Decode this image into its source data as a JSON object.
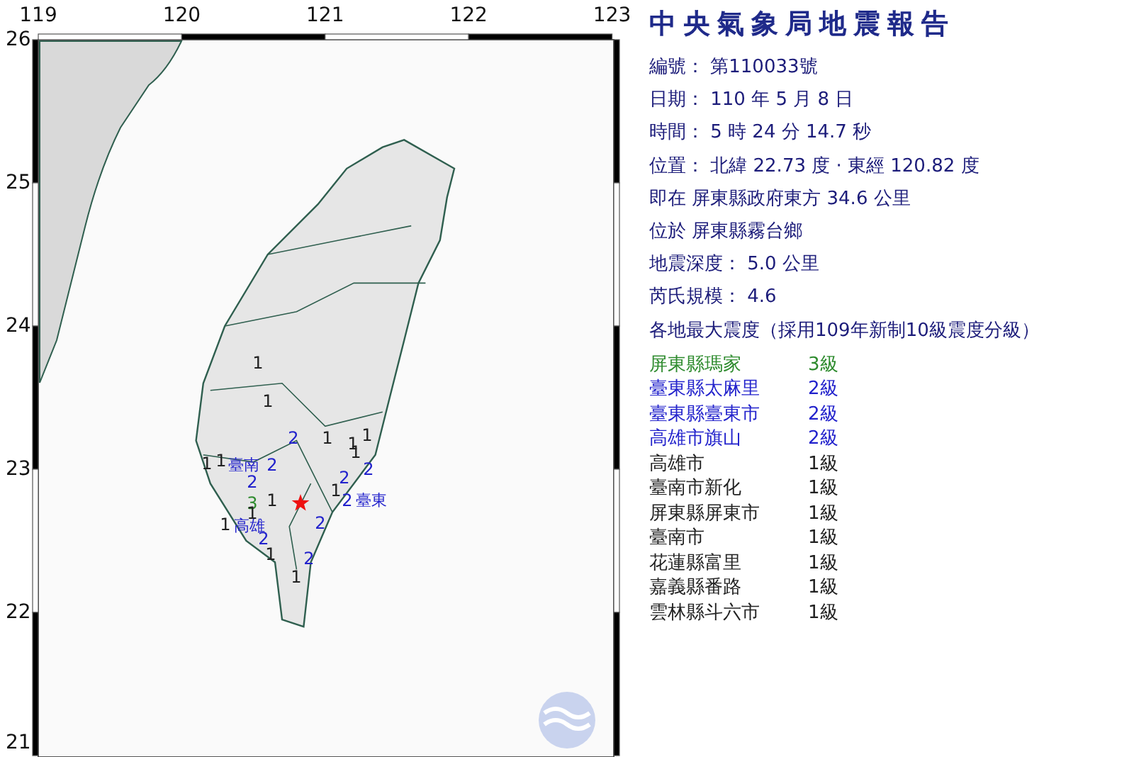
{
  "map": {
    "lon_ticks": [
      "119",
      "120",
      "121",
      "122",
      "123"
    ],
    "lat_ticks": [
      "26",
      "25",
      "24",
      "23",
      "22",
      "21"
    ],
    "place_labels": [
      "臺南",
      "高雄",
      "臺東"
    ],
    "markers": [
      {
        "text": "1",
        "color": "#222222"
      },
      {
        "text": "1",
        "color": "#222222"
      },
      {
        "text": "2",
        "color": "#2222cc"
      },
      {
        "text": "1",
        "color": "#222222"
      },
      {
        "text": "1",
        "color": "#222222"
      },
      {
        "text": "1",
        "color": "#222222"
      },
      {
        "text": "1",
        "color": "#222222"
      },
      {
        "text": "1",
        "color": "#222222"
      },
      {
        "text": "1",
        "color": "#222222"
      },
      {
        "text": "2",
        "color": "#2222cc"
      },
      {
        "text": "2",
        "color": "#2222cc"
      },
      {
        "text": "2",
        "color": "#2222cc"
      },
      {
        "text": "2",
        "color": "#2222cc"
      },
      {
        "text": "1",
        "color": "#222222"
      },
      {
        "text": "3",
        "color": "#2e8b2e"
      },
      {
        "text": "1",
        "color": "#222222"
      },
      {
        "text": "2",
        "color": "#2222cc"
      },
      {
        "text": "1",
        "color": "#222222"
      },
      {
        "text": "2",
        "color": "#2222cc"
      },
      {
        "text": "2",
        "color": "#2222cc"
      },
      {
        "text": "1",
        "color": "#222222"
      },
      {
        "text": "1",
        "color": "#222222"
      },
      {
        "text": "2",
        "color": "#2222cc"
      },
      {
        "text": "1",
        "color": "#222222"
      }
    ]
  },
  "report": {
    "title": "中央氣象局地震報告",
    "lines": [
      "編號： 第110033號",
      "日期： 110 年 5 月 8 日",
      "時間： 5 時 24 分 14.7 秒",
      "位置： 北緯 22.73 度 · 東經 120.82 度",
      "即在 屏東縣政府東方 34.6 公里",
      "位於 屏東縣霧台鄉",
      "地震深度： 5.0 公里",
      "芮氏規模： 4.6",
      "各地最大震度（採用109年新制10級震度分級）"
    ]
  },
  "stations": [
    {
      "name": "屏東縣瑪家",
      "intensity": "3級",
      "color": "#2e8b2e"
    },
    {
      "name": "臺東縣太麻里",
      "intensity": "2級",
      "color": "#2222cc"
    },
    {
      "name": "臺東縣臺東市",
      "intensity": "2級",
      "color": "#2222cc"
    },
    {
      "name": "高雄市旗山",
      "intensity": "2級",
      "color": "#2222cc"
    },
    {
      "name": "高雄市",
      "intensity": "1級",
      "color": "#222222"
    },
    {
      "name": "臺南市新化",
      "intensity": "1級",
      "color": "#222222"
    },
    {
      "name": "屏東縣屏東市",
      "intensity": "1級",
      "color": "#222222"
    },
    {
      "name": "臺南市",
      "intensity": "1級",
      "color": "#222222"
    },
    {
      "name": "花蓮縣富里",
      "intensity": "1級",
      "color": "#222222"
    },
    {
      "name": "嘉義縣番路",
      "intensity": "1級",
      "color": "#222222"
    },
    {
      "name": "雲林縣斗六市",
      "intensity": "1級",
      "color": "#222222"
    }
  ]
}
